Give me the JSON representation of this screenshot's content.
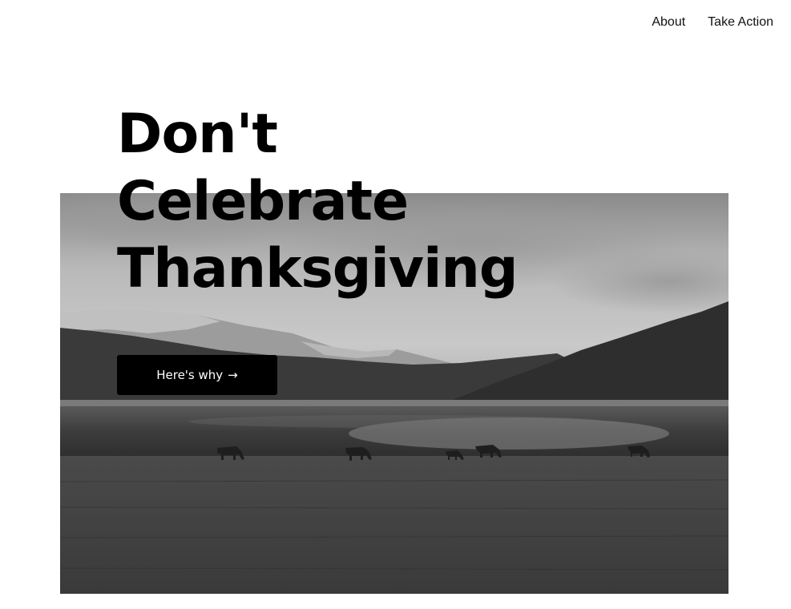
{
  "nav": {
    "items": [
      {
        "label": "About"
      },
      {
        "label": "Take Action"
      }
    ]
  },
  "hero": {
    "headline_lines": [
      "Don't",
      "Celebrate",
      "Thanksgiving"
    ],
    "cta_label": "Here's why",
    "cta_arrow": "→",
    "image": {
      "subject": "grayscale landscape with mountains, lake and grazing horses",
      "palette": [
        "#2a2a2a",
        "#6a6a6a",
        "#c8c8c8"
      ]
    }
  },
  "colors": {
    "background": "#ffffff",
    "text": "#000000",
    "button_bg": "#000000",
    "button_text": "#ffffff"
  }
}
